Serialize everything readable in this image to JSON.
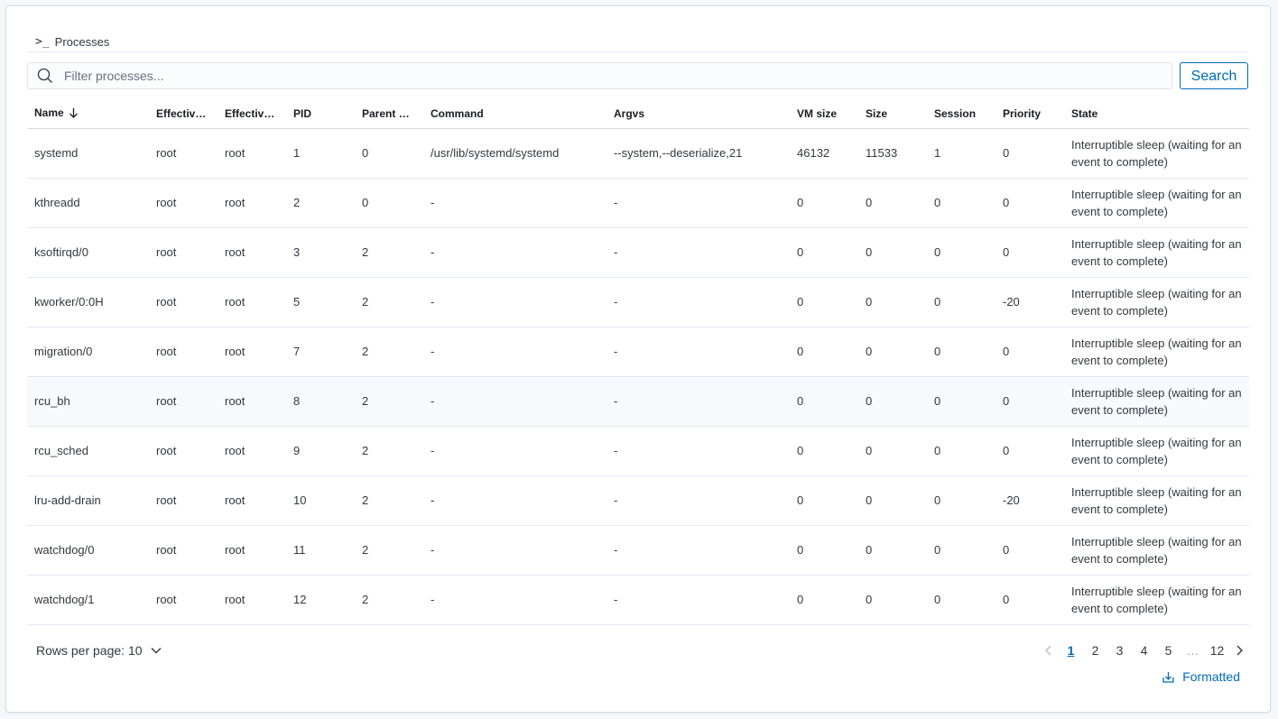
{
  "header": {
    "prompt_glyph": ">_",
    "title": "Processes"
  },
  "search": {
    "placeholder": "Filter processes...",
    "value": "",
    "button_label": "Search"
  },
  "table": {
    "columns": [
      "Name",
      "Effective ...",
      "Effective ...",
      "PID",
      "Parent PID",
      "Command",
      "Argvs",
      "VM size",
      "Size",
      "Session",
      "Priority",
      "State"
    ],
    "sort_column": "Name",
    "rows": [
      [
        "systemd",
        "root",
        "root",
        "1",
        "0",
        "/usr/lib/systemd/systemd",
        "--system,--deserialize,21",
        "46132",
        "11533",
        "1",
        "0",
        "Interruptible sleep (waiting for an event to complete)"
      ],
      [
        "kthreadd",
        "root",
        "root",
        "2",
        "0",
        "-",
        "-",
        "0",
        "0",
        "0",
        "0",
        "Interruptible sleep (waiting for an event to complete)"
      ],
      [
        "ksoftirqd/0",
        "root",
        "root",
        "3",
        "2",
        "-",
        "-",
        "0",
        "0",
        "0",
        "0",
        "Interruptible sleep (waiting for an event to complete)"
      ],
      [
        "kworker/0:0H",
        "root",
        "root",
        "5",
        "2",
        "-",
        "-",
        "0",
        "0",
        "0",
        "-20",
        "Interruptible sleep (waiting for an event to complete)"
      ],
      [
        "migration/0",
        "root",
        "root",
        "7",
        "2",
        "-",
        "-",
        "0",
        "0",
        "0",
        "0",
        "Interruptible sleep (waiting for an event to complete)"
      ],
      [
        "rcu_bh",
        "root",
        "root",
        "8",
        "2",
        "-",
        "-",
        "0",
        "0",
        "0",
        "0",
        "Interruptible sleep (waiting for an event to complete)"
      ],
      [
        "rcu_sched",
        "root",
        "root",
        "9",
        "2",
        "-",
        "-",
        "0",
        "0",
        "0",
        "0",
        "Interruptible sleep (waiting for an event to complete)"
      ],
      [
        "lru-add-drain",
        "root",
        "root",
        "10",
        "2",
        "-",
        "-",
        "0",
        "0",
        "0",
        "-20",
        "Interruptible sleep (waiting for an event to complete)"
      ],
      [
        "watchdog/0",
        "root",
        "root",
        "11",
        "2",
        "-",
        "-",
        "0",
        "0",
        "0",
        "0",
        "Interruptible sleep (waiting for an event to complete)"
      ],
      [
        "watchdog/1",
        "root",
        "root",
        "12",
        "2",
        "-",
        "-",
        "0",
        "0",
        "0",
        "0",
        "Interruptible sleep (waiting for an event to complete)"
      ]
    ]
  },
  "footer": {
    "rows_per_page_label": "Rows per page: 10",
    "pages": [
      "1",
      "2",
      "3",
      "4",
      "5",
      "…",
      "12"
    ],
    "active_page": "1",
    "export_label": "Formatted"
  },
  "colors": {
    "accent": "#006bb8",
    "text": "#343741",
    "border": "#d3dae6"
  },
  "icons": {
    "header": "terminal-icon",
    "search": "search-icon",
    "sort": "arrow-down-icon",
    "dropdown": "chevron-down-icon",
    "prev": "chevron-left-icon",
    "next": "chevron-right-icon",
    "export": "download-icon"
  }
}
